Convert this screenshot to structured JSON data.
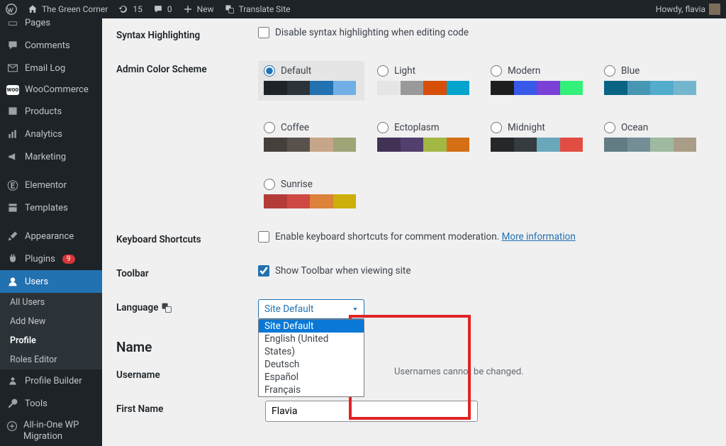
{
  "adminbar": {
    "site_name": "The Green Corner",
    "updates": "15",
    "comments": "0",
    "new": "New",
    "translate": "Translate Site",
    "howdy": "Howdy, flavia"
  },
  "sidebar": {
    "pages": "Pages",
    "comments": "Comments",
    "email_log": "Email Log",
    "woocommerce": "WooCommerce",
    "products": "Products",
    "analytics": "Analytics",
    "marketing": "Marketing",
    "elementor": "Elementor",
    "templates": "Templates",
    "appearance": "Appearance",
    "plugins": "Plugins",
    "plugins_count": "9",
    "users": "Users",
    "sub_all": "All Users",
    "sub_add": "Add New",
    "sub_profile": "Profile",
    "sub_roles": "Roles Editor",
    "profile_builder": "Profile Builder",
    "tools": "Tools",
    "aio": "All-in-One WP Migration"
  },
  "labels": {
    "syntax": "Syntax Highlighting",
    "syntax_cb": "Disable syntax highlighting when editing code",
    "scheme": "Admin Color Scheme",
    "kb": "Keyboard Shortcuts",
    "kb_cb": "Enable keyboard shortcuts for comment moderation.",
    "kb_more": "More information",
    "toolbar": "Toolbar",
    "toolbar_cb": "Show Toolbar when viewing site",
    "language": "Language",
    "name_section": "Name",
    "username": "Username",
    "username_note": "Usernames cannot be changed.",
    "firstname": "First Name"
  },
  "schemes": {
    "default": "Default",
    "light": "Light",
    "modern": "Modern",
    "blue": "Blue",
    "coffee": "Coffee",
    "ectoplasm": "Ectoplasm",
    "midnight": "Midnight",
    "ocean": "Ocean",
    "sunrise": "Sunrise"
  },
  "language_select": {
    "current": "Site Default",
    "options": [
      "Site Default",
      "English (United States)",
      "Deutsch",
      "Español",
      "Français"
    ]
  },
  "user": {
    "first_name": "Flavia"
  }
}
